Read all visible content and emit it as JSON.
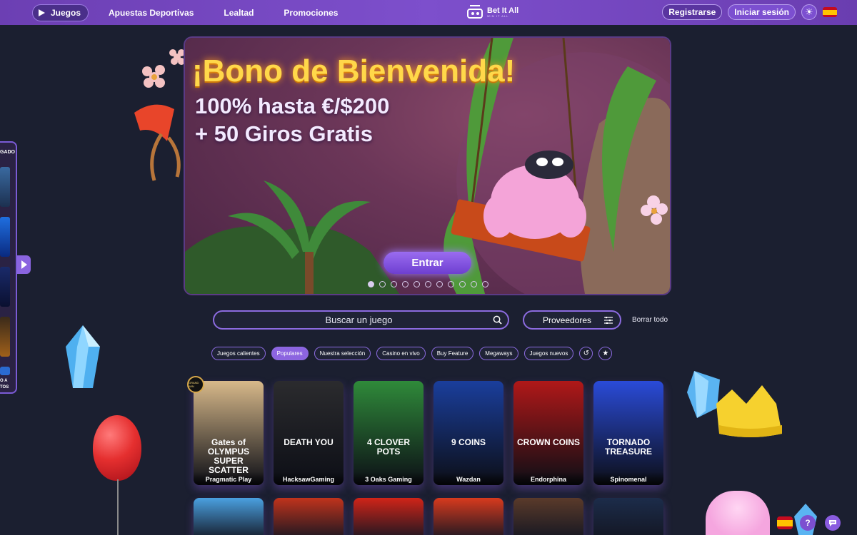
{
  "header": {
    "nav": [
      "Juegos",
      "Apuestas Deportivas",
      "Lealtad",
      "Promociones"
    ],
    "logo_title": "Bet It All",
    "logo_tagline": "WIN IT ALL",
    "register_label": "Registrarse",
    "login_label": "Iniciar sesión"
  },
  "side_panel": {
    "label": "GADO",
    "bottom_label_1": "O A",
    "bottom_label_2": "TOS"
  },
  "banner": {
    "title": "¡Bono de Bienvenida!",
    "line1": "100% hasta €/$200",
    "line2": "+ 50 Giros Gratis",
    "cta": "Entrar",
    "slide_count": 11,
    "active_slide": 1
  },
  "search": {
    "placeholder": "Buscar un juego",
    "providers_label": "Proveedores",
    "clear_all": "Borrar todo"
  },
  "chips": [
    "Juegos calientes",
    "Populares",
    "Nuestra selección",
    "Casino en vivo",
    "Buy Feature",
    "Megaways",
    "Juegos nuevos"
  ],
  "active_chip": "Populares",
  "games_row1": [
    {
      "title": "Gates of OLYMPUS SUPER SCATTER",
      "provider": "Pragmatic Play",
      "color": "#d8b98a"
    },
    {
      "title": "DEATH YOU",
      "provider": "HacksawGaming",
      "color": "#2b2b2e"
    },
    {
      "title": "4 CLOVER POTS",
      "provider": "3 Oaks Gaming",
      "color": "#2f8a3a"
    },
    {
      "title": "9 COINS",
      "provider": "Wazdan",
      "color": "#1a3e9c"
    },
    {
      "title": "CROWN COINS",
      "provider": "Endorphina",
      "color": "#b01818"
    },
    {
      "title": "TORNADO TREASURE",
      "provider": "Spinomenal",
      "color": "#2a4bd8"
    }
  ],
  "games_row2": [
    {
      "color": "#4aa0e0"
    },
    {
      "color": "#c0331c"
    },
    {
      "color": "#d02418"
    },
    {
      "color": "#d83a1e"
    },
    {
      "color": "#5a3a2a"
    },
    {
      "color": "#1c2c4a"
    }
  ],
  "badge_text": "GRAND WIN",
  "help_label": "?"
}
